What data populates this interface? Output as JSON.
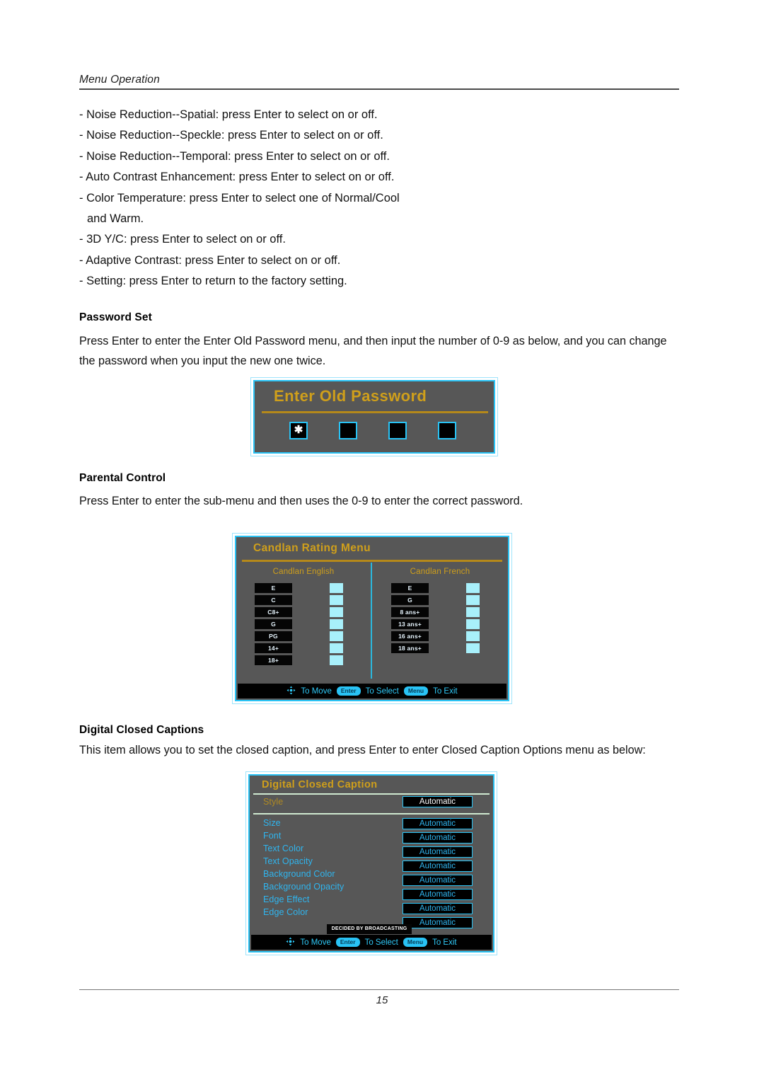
{
  "page": {
    "running_head": "Menu Operation",
    "number": "15"
  },
  "bullets": [
    {
      "text": "- Noise Reduction--Spatial: press Enter to select on or off.",
      "indent": false
    },
    {
      "text": "- Noise Reduction--Speckle: press Enter to select on or off.",
      "indent": false
    },
    {
      "text": "- Noise Reduction--Temporal: press Enter to select on or off.",
      "indent": false
    },
    {
      "text": "- Auto Contrast Enhancement: press Enter to select on or off.",
      "indent": false
    },
    {
      "text": "- Color Temperature: press Enter to select one of Normal/Cool",
      "indent": false
    },
    {
      "text": "and Warm.",
      "indent": true
    },
    {
      "text": "- 3D Y/C: press Enter to select on or off.",
      "indent": false
    },
    {
      "text": "- Adaptive Contrast: press Enter to select on or off.",
      "indent": false
    },
    {
      "text": "- Setting: press Enter to return to the factory setting.",
      "indent": false
    }
  ],
  "sections": {
    "password_set": {
      "heading": "Password Set",
      "paragraph": "Press Enter to enter the Enter Old Password menu, and then input the number of 0-9 as below, and you can change the password when you input the new one twice."
    },
    "parental_control": {
      "heading": "Parental Control",
      "paragraph": "Press Enter to enter the sub-menu and then uses the 0-9 to enter the correct password."
    },
    "digital_closed_captions": {
      "heading": "Digital Closed Captions",
      "paragraph": "This item allows you to set the closed caption, and press Enter to enter Closed Caption Options menu as below:"
    }
  },
  "password_osd": {
    "title": "Enter Old Password",
    "digits": [
      "✱",
      "",
      "",
      ""
    ]
  },
  "rating_osd": {
    "title": "Candlan Rating Menu",
    "columns": [
      {
        "header": "Candlan English",
        "ratings": [
          "E",
          "C",
          "C8+",
          "G",
          "PG",
          "14+",
          "18+"
        ]
      },
      {
        "header": "Candlan French",
        "ratings": [
          "E",
          "G",
          "8 ans+",
          "13 ans+",
          "16 ans+",
          "18 ans+"
        ]
      }
    ]
  },
  "dcc_osd": {
    "title": "Digital Closed Caption",
    "rows": [
      {
        "label": "Style",
        "value": "Automatic",
        "selected": true
      },
      {
        "label": "Size",
        "value": "Automatic",
        "selected": false
      },
      {
        "label": "Font",
        "value": "Automatic",
        "selected": false
      },
      {
        "label": "Text Color",
        "value": "Automatic",
        "selected": false
      },
      {
        "label": "Text Opacity",
        "value": "Automatic",
        "selected": false
      },
      {
        "label": "Background Color",
        "value": "Automatic",
        "selected": false
      },
      {
        "label": "Background Opacity",
        "value": "Automatic",
        "selected": false
      },
      {
        "label": "Edge Effect",
        "value": "Automatic",
        "selected": false
      },
      {
        "label": "Edge Color",
        "value": "Automatic",
        "selected": false
      }
    ],
    "note": "DECIDED BY BROADCASTING"
  },
  "osd_footer": {
    "move_label": "To Move",
    "enter_key": "Enter",
    "select_label": "To Select",
    "menu_key": "Menu",
    "exit_label": "To Exit"
  },
  "colors": {
    "osd_background": "#575757",
    "osd_border_cyan": "#29c3f5",
    "osd_title_gold": "#cf9f1b",
    "osd_label_cyan": "#2fb5ef",
    "osd_check_cyan": "#a8f0fb",
    "osd_footer_black": "#010101"
  }
}
